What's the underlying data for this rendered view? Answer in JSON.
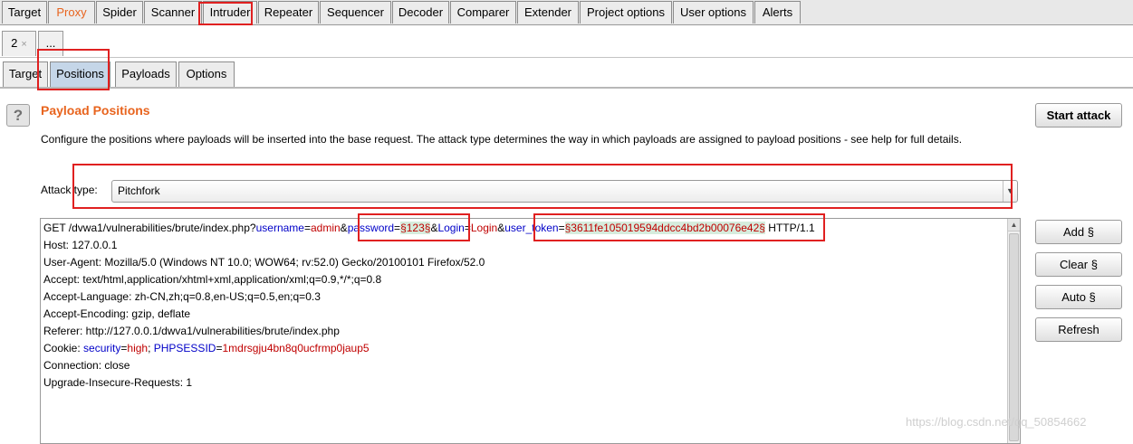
{
  "top_tabs": [
    "Target",
    "Proxy",
    "Spider",
    "Scanner",
    "Intruder",
    "Repeater",
    "Sequencer",
    "Decoder",
    "Comparer",
    "Extender",
    "Project options",
    "User options",
    "Alerts"
  ],
  "attack_tabs": {
    "tab1": "2",
    "tab1_close": "×",
    "more": "..."
  },
  "intruder_tabs": [
    "Target",
    "Positions",
    "Payloads",
    "Options"
  ],
  "panel": {
    "help_icon": "?",
    "title": "Payload Positions",
    "description": "Configure the positions where payloads will be inserted into the base request. The attack type determines the way in which payloads are assigned to payload positions - see help for full details.",
    "attack_type_label": "Attack type:",
    "attack_type_value": "Pitchfork",
    "start_attack": "Start attack"
  },
  "request": {
    "line1": {
      "prefix": "GET /dvwa1/vulnerabilities/brute/index.php?",
      "p1_key": "username",
      "eq": "=",
      "p1_val": "admin",
      "amp": "&",
      "p2_key": "password",
      "p2_payload": "§123§",
      "p3_key": "Login",
      "p3_val": "Login",
      "p4_key": "user_token",
      "p4_payload": "§3611fe105019594ddcc4bd2b00076e42§",
      "suffix": " HTTP/1.1"
    },
    "host": "Host: 127.0.0.1",
    "user_agent": "User-Agent: Mozilla/5.0 (Windows NT 10.0; WOW64; rv:52.0) Gecko/20100101 Firefox/52.0",
    "accept": "Accept: text/html,application/xhtml+xml,application/xml;q=0.9,*/*;q=0.8",
    "accept_language": "Accept-Language: zh-CN,zh;q=0.8,en-US;q=0.5,en;q=0.3",
    "accept_encoding": "Accept-Encoding: gzip, deflate",
    "referer": "Referer: http://127.0.0.1/dwva1/vulnerabilities/brute/index.php",
    "cookie": {
      "prefix": "Cookie: ",
      "k1": "security",
      "v1": "high",
      "sep": "; ",
      "k2": "PHPSESSID",
      "v2": "1mdrsgju4bn8q0ucfrmp0jaup5"
    },
    "connection": "Connection: close",
    "upgrade": "Upgrade-Insecure-Requests: 1"
  },
  "side_buttons": {
    "add": "Add §",
    "clear": "Clear §",
    "auto": "Auto §",
    "refresh": "Refresh"
  },
  "watermark": "https://blog.csdn.net/qq_50854662",
  "colors": {
    "accent": "#e8641e",
    "highlight": "#e02020",
    "param_key": "#0000c8",
    "param_value": "#c00000",
    "payload_bg": "#d6ecdd"
  }
}
